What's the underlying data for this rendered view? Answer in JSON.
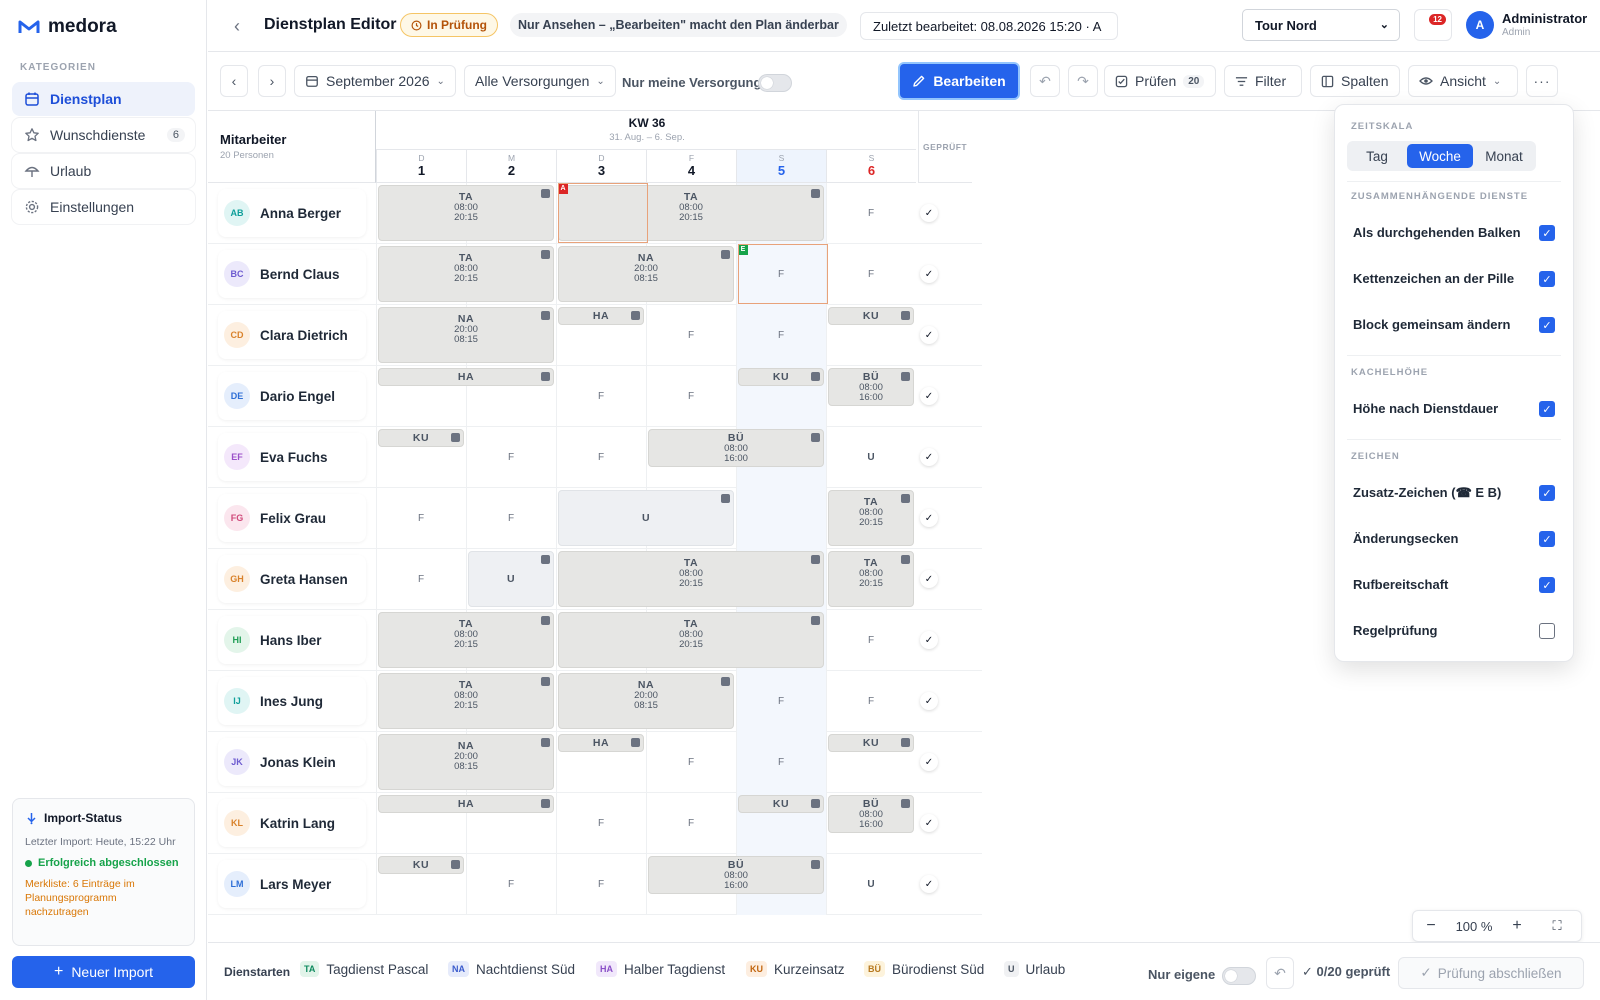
{
  "sidebar": {
    "brand": "medora",
    "section": "KATEGORIEN",
    "items": [
      {
        "label": "Dienstplan",
        "icon": "calendar-icon",
        "active": true
      },
      {
        "label": "Wunschdienste",
        "icon": "star-icon",
        "badge": "6"
      },
      {
        "label": "Urlaub",
        "icon": "umbrella-icon"
      },
      {
        "label": "Einstellungen",
        "icon": "gear-icon"
      }
    ],
    "import": {
      "title": "Import-Status",
      "last": "Letzter Import: Heute, 15:22 Uhr",
      "status": "Erfolgreich abgeschlossen",
      "note": "Merkliste: 6 Einträge im Planungsprogramm nachzutragen"
    },
    "new_import": "Neuer Import"
  },
  "topbar": {
    "title": "Dienstplan Editor",
    "status": "In Prüfung",
    "view_only": "Nur Ansehen – „Bearbeiten\" macht den Plan änderbar",
    "edited": "Zuletzt bearbeitet:  08.08.2026 15:20 · A",
    "tour": "Tour Nord",
    "notifications": "12",
    "user_initial": "A",
    "user": "Administrator",
    "role": "Admin"
  },
  "toolbar": {
    "month": "September 2026",
    "supply": "Alle Versorgungen",
    "own_supply": "Nur meine Versorgung",
    "edit": "Bearbeiten",
    "check": "Prüfen",
    "check_count": "20",
    "filter": "Filter",
    "columns": "Spalten",
    "view": "Ansicht"
  },
  "grid": {
    "employees_title": "Mitarbeiter",
    "employees_count": "20 Personen",
    "week": "KW 36",
    "week_range": "31. Aug. – 6. Sep.",
    "checked_label": "GEPRÜFT",
    "days": [
      {
        "wd": "D",
        "n": "1"
      },
      {
        "wd": "M",
        "n": "2"
      },
      {
        "wd": "D",
        "n": "3"
      },
      {
        "wd": "F",
        "n": "4"
      },
      {
        "wd": "S",
        "n": "5"
      },
      {
        "wd": "S",
        "n": "6"
      }
    ],
    "employees": [
      {
        "initials": "AB",
        "name": "Anna Berger",
        "color": "#0e9f9a",
        "bg": "#e0f5f4"
      },
      {
        "initials": "BC",
        "name": "Bernd Claus",
        "color": "#6d5bd0",
        "bg": "#ece9fb"
      },
      {
        "initials": "CD",
        "name": "Clara Dietrich",
        "color": "#d9822b",
        "bg": "#fdefe0"
      },
      {
        "initials": "DE",
        "name": "Dario Engel",
        "color": "#2f6fd6",
        "bg": "#e5eefc"
      },
      {
        "initials": "EF",
        "name": "Eva Fuchs",
        "color": "#9b51c9",
        "bg": "#f4e8fb"
      },
      {
        "initials": "FG",
        "name": "Felix Grau",
        "color": "#d04a7b",
        "bg": "#fbe6ee"
      },
      {
        "initials": "GH",
        "name": "Greta Hansen",
        "color": "#d9822b",
        "bg": "#fdefe0"
      },
      {
        "initials": "HI",
        "name": "Hans Iber",
        "color": "#1f9d55",
        "bg": "#e3f5ea"
      },
      {
        "initials": "IJ",
        "name": "Ines Jung",
        "color": "#0e9f9a",
        "bg": "#e0f5f4"
      },
      {
        "initials": "JK",
        "name": "Jonas Klein",
        "color": "#6d5bd0",
        "bg": "#ece9fb"
      },
      {
        "initials": "KL",
        "name": "Katrin Lang",
        "color": "#d9822b",
        "bg": "#fdefe0"
      },
      {
        "initials": "LM",
        "name": "Lars Meyer",
        "color": "#2f6fd6",
        "bg": "#e5eefc"
      }
    ],
    "free": "F",
    "vacation": "U",
    "shifts": {
      "TA": {
        "code": "TA",
        "t1": "08:00",
        "t2": "20:15"
      },
      "NA": {
        "code": "NA",
        "t1": "20:00",
        "t2": "08:15"
      },
      "BU": {
        "code": "BÜ",
        "t1": "08:00",
        "t2": "16:00"
      },
      "HA": {
        "code": "HA"
      },
      "KU": {
        "code": "KU"
      }
    },
    "flags": {
      "a": "A",
      "e": "E"
    }
  },
  "legend": {
    "title": "Dienstarten",
    "items": [
      {
        "key": "TA",
        "label": "Tagdienst Pascal",
        "fg": "#0f8a5f",
        "bg": "#e2f4ea"
      },
      {
        "key": "NA",
        "label": "Nachtdienst Süd",
        "fg": "#3b5bcc",
        "bg": "#e6ebfb"
      },
      {
        "key": "HA",
        "label": "Halber Tagdienst",
        "fg": "#8a4fc7",
        "bg": "#f1e8fb"
      },
      {
        "key": "KU",
        "label": "Kurzeinsatz",
        "fg": "#c2660f",
        "bg": "#fdeee0"
      },
      {
        "key": "BÜ",
        "label": "Bürodienst Süd",
        "fg": "#b7791f",
        "bg": "#fdf3dc"
      },
      {
        "key": "U",
        "label": "Urlaub",
        "fg": "#4b5563",
        "bg": "#f0f1f3"
      }
    ],
    "own": "Nur eigene",
    "checked": "0/20 geprüft",
    "finish": "Prüfung abschließen"
  },
  "zoom": {
    "level": "100 %"
  },
  "view_panel": {
    "scale_title": "ZEITSKALA",
    "scale": [
      "Tag",
      "Woche",
      "Monat"
    ],
    "scale_selected": "Woche",
    "connected_title": "ZUSAMMENHÄNGENDE DIENSTE",
    "opt_bar": "Als durchgehenden Balken",
    "opt_chain": "Kettenzeichen an der Pille",
    "opt_block": "Block gemeinsam ändern",
    "height_title": "KACHELHÖHE",
    "opt_height": "Höhe nach Dienstdauer",
    "signs_title": "ZEICHEN",
    "opt_extra": "Zusatz-Zeichen (☎ E B)",
    "opt_corners": "Änderungsecken",
    "opt_oncall": "Rufbereitschaft",
    "opt_rules": "Regelprüfung"
  }
}
